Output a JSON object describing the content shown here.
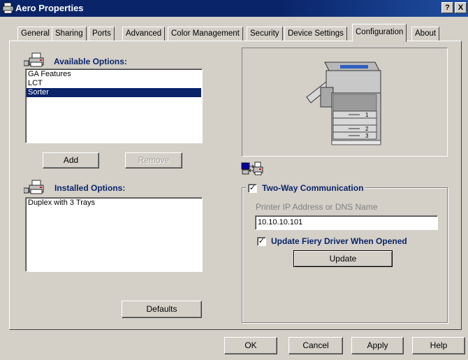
{
  "window": {
    "title": "Aero Properties",
    "help_button": "?",
    "close_button": "X"
  },
  "tabs": [
    {
      "label": "General",
      "active": false
    },
    {
      "label": "Sharing",
      "active": false
    },
    {
      "label": "Ports",
      "active": false
    },
    {
      "label": "Advanced",
      "active": false
    },
    {
      "label": "Color Management",
      "active": false
    },
    {
      "label": "Security",
      "active": false
    },
    {
      "label": "Device Settings",
      "active": false
    },
    {
      "label": "Configuration",
      "active": true
    },
    {
      "label": "About",
      "active": false
    }
  ],
  "available_options": {
    "heading": "Available Options:",
    "items": [
      {
        "label": "GA Features",
        "selected": false
      },
      {
        "label": "LCT",
        "selected": false
      },
      {
        "label": "Sorter",
        "selected": true
      }
    ],
    "add_button": "Add",
    "remove_button": "Remove"
  },
  "installed_options": {
    "heading": "Installed Options:",
    "items": [
      {
        "label": "Duplex with 3 Trays"
      }
    ],
    "defaults_button": "Defaults"
  },
  "printer_image": {
    "trays": [
      "1",
      "2",
      "3"
    ]
  },
  "two_way": {
    "label": "Two-Way Communication",
    "checked": true,
    "ip_label": "Printer IP Address or DNS Name",
    "ip_value": "10.10.10.101",
    "update_driver_label": "Update Fiery Driver When Opened",
    "update_driver_checked": true,
    "update_button": "Update"
  },
  "footer": {
    "ok": "OK",
    "cancel": "Cancel",
    "apply": "Apply",
    "help": "Help"
  },
  "colors": {
    "titlebar": "#0a246a",
    "selection": "#0a246a",
    "face": "#d4d0c8"
  }
}
